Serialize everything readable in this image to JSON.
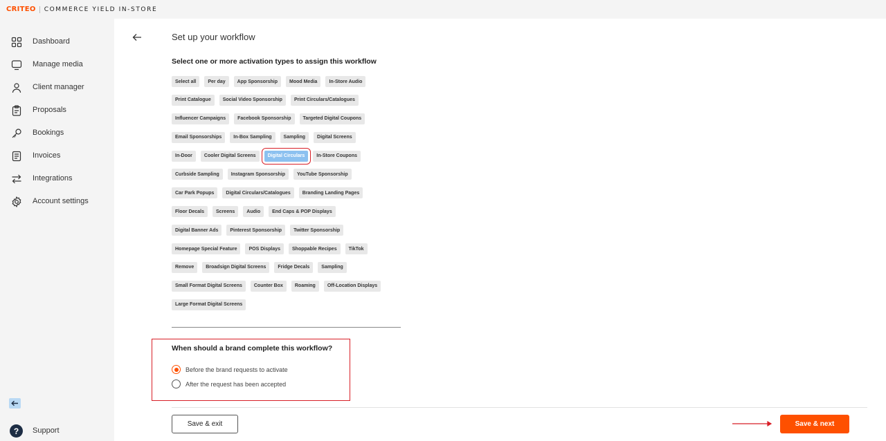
{
  "header": {
    "brand": "CRITEO",
    "product": "COMMERCE YIELD IN-STORE",
    "brand_color": "#fe5000"
  },
  "sidebar": {
    "items": [
      {
        "label": "Dashboard",
        "icon": "dashboard-grid-icon"
      },
      {
        "label": "Manage media",
        "icon": "monitor-icon"
      },
      {
        "label": "Client manager",
        "icon": "user-icon"
      },
      {
        "label": "Proposals",
        "icon": "clipboard-icon"
      },
      {
        "label": "Bookings",
        "icon": "key-icon"
      },
      {
        "label": "Invoices",
        "icon": "document-icon"
      },
      {
        "label": "Integrations",
        "icon": "arrows-exchange-icon"
      },
      {
        "label": "Account settings",
        "icon": "gear-icon"
      }
    ],
    "collapse_icon": "arrow-left-icon",
    "support_label": "Support",
    "support_icon": "question-icon"
  },
  "main": {
    "title": "Set up your workflow",
    "activation_title": "Select one or more activation types to assign this workflow",
    "chip_rows": [
      [
        "Select all",
        "Per day",
        "App Sponsorship",
        "Mood Media",
        "In-Store Audio"
      ],
      [
        "Print Catalogue",
        "Social Video Sponsorship",
        "Print Circulars/Catalogues"
      ],
      [
        "Influencer Campaigns",
        "Facebook Sponsorship",
        "Targeted Digital Coupons"
      ],
      [
        "Email Sponsorships",
        "In-Box Sampling",
        "Sampling",
        "Digital Screens"
      ],
      [
        "In-Door",
        "Cooler Digital Screens",
        "Digital Circulars",
        "In-Store Coupons"
      ],
      [
        "Curbside Sampling",
        "Instagram Sponsorship",
        "YouTube Sponsorship"
      ],
      [
        "Car Park Popups",
        "Digital Circulars/Catalogues",
        "Branding Landing Pages"
      ],
      [
        "Floor Decals",
        "Screens",
        "Audio",
        "End Caps & POP Displays"
      ],
      [
        "Digital Banner Ads",
        "Pinterest Sponsorship",
        "Twitter Sponsorship"
      ],
      [
        "Homepage Special Feature",
        "POS Displays",
        "Shoppable Recipes",
        "TikTok"
      ],
      [
        "Remove",
        "Broadsign Digital Screens",
        "Fridge Decals",
        "Sampling"
      ],
      [
        "Small Format Digital Screens",
        "Counter Box",
        "Roaming",
        "Off-Location Displays"
      ],
      [
        "Large Format Digital Screens"
      ]
    ],
    "selected_chip": "Digital Circulars",
    "timing": {
      "title": "When should a brand complete this workflow?",
      "options": [
        {
          "label": "Before the brand requests to activate",
          "checked": true
        },
        {
          "label": "After the request has been accepted",
          "checked": false
        }
      ]
    },
    "footer": {
      "save_exit_label": "Save & exit",
      "save_next_label": "Save & next"
    }
  },
  "colors": {
    "accent": "#fe5000",
    "highlight_border": "#d81e26",
    "selected_chip": "#8cc1f0",
    "chip_bg": "#e8e8e8",
    "sidebar_bg": "#f4f4f4"
  }
}
